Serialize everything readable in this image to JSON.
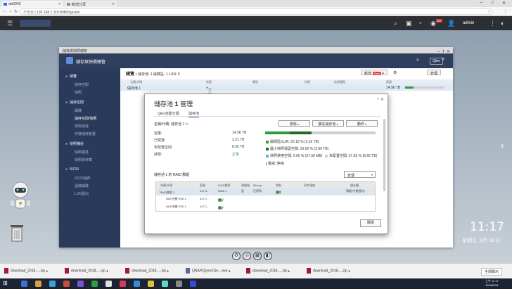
{
  "browser": {
    "tabs": [
      "dw0342",
      "新增分頁"
    ],
    "url_security": "不安全",
    "url": "192.168.1.115:8080/cgi-bin/"
  },
  "qts": {
    "user": "admin",
    "badge": "10+"
  },
  "app": {
    "window_title": "儲存與快照總管",
    "header_title": "儲存與快照總管",
    "qtier": "Qtier",
    "breadcrumb_pre": "總覽 ›",
    "breadcrumb_mid": "儲存池: 1  磁碟區: 1  LUN: 0",
    "new_btn": "新增",
    "new_badge": "New",
    "manage_btn": "管理",
    "table_headers": [
      "名稱/代碼",
      "狀態",
      "類型",
      "快照",
      "快照複寫",
      "容量"
    ],
    "table_row": {
      "name": "儲存池 1",
      "status": "正常",
      "capacity": "14.96 TB"
    },
    "sidebar": [
      {
        "section": "總覽",
        "items": [
          "儲存空間",
          "快照"
        ]
      },
      {
        "section": "儲存空間",
        "items": [
          "磁碟",
          "儲存空間/快照",
          "快取加速",
          "外接儲存裝置"
        ]
      },
      {
        "section": "快照備份",
        "items": [
          "快照複寫",
          "快照保存庫"
        ]
      },
      {
        "section": "iSCSI",
        "items": [
          "iSCSI儲存",
          "遠端磁碟",
          "LUN匯出"
        ]
      }
    ]
  },
  "modal": {
    "title_pre": "儲存池",
    "title_num": "1",
    "title_post": "管理",
    "tabs": [
      "Qtier自動分層",
      "儲存池"
    ],
    "pool_label": "名稱/代碼: 儲存池 1",
    "buttons": [
      "移除",
      "擴充儲存池",
      "動作"
    ],
    "fields": [
      {
        "k": "容量:",
        "v": "14.96 TB"
      },
      {
        "k": "已配置:",
        "v": "3.31 TB"
      },
      {
        "k": "未配置空間:",
        "v": "8.65 TB"
      },
      {
        "k": "狀態:",
        "v": "正常"
      }
    ],
    "legend": [
      "磁碟區/LUN: 22.18 % (3.32 TB)",
      "最小快照保留空間: 20.00 % (2.99 TB)",
      "快照使用空間: 0.00 % (37.50 MB)",
      "未配置空間: 57.82 % (8.65 TB)",
      "警戒: 停用"
    ],
    "bar_values": [
      22.18,
      20.0,
      0.0,
      57.82
    ],
    "colors": {
      "volume": "#2e9b3e",
      "reserve": "#1c6b2a",
      "snapshot": "#56b8e6",
      "free": "#cfcfcf",
      "alert": "#c0392b"
    },
    "raid_title": "儲存池 1 的 RAID 群組",
    "manage": "管理",
    "raid_headers": [
      "名稱/代碼",
      "容量",
      "RAID類型",
      "熱備援",
      "Bitmap",
      "狀態",
      "同步速度",
      "優先權"
    ],
    "raid_rows": [
      [
        "RAID群組 1",
        "437.9...",
        "RAID 1",
        "否",
        "已停用",
        "正常",
        "",
        "預設(中速程式)"
      ],
      [
        "NAS主機 SSD 1",
        "447.1...",
        "",
        "",
        "",
        "",
        "",
        ""
      ],
      [
        "NAS主機 SSD 2",
        "447.1...",
        "",
        "",
        "",
        "",
        "",
        ""
      ]
    ],
    "raid_disk_status": "良好",
    "close": "關閉"
  },
  "desktop": {
    "time": "11:17",
    "date": "星期五, 5月 18 日"
  },
  "downloads": {
    "items": [
      "download_2018-....zip",
      "download_2018-....zip",
      "download_2018-....zip",
      "QNAPQsyncClie....exe",
      "download_2018-....zip",
      "download_2018-....zip"
    ],
    "show_all": "全部顯示"
  },
  "taskbar": {
    "time": "上午 11:17",
    "date": "2018/5/18"
  }
}
